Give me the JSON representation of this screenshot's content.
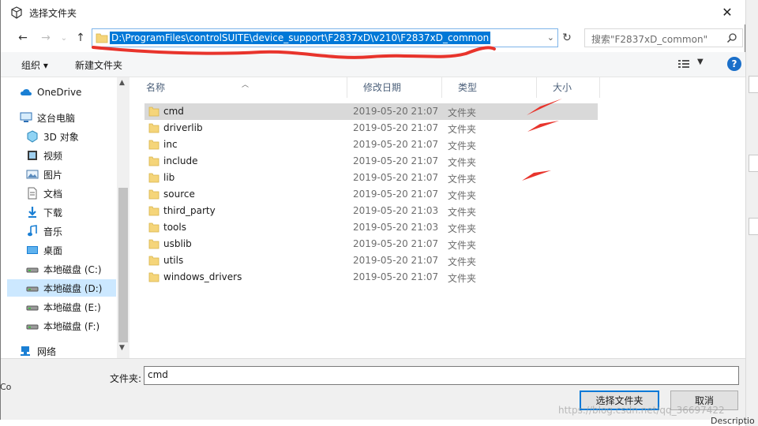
{
  "window": {
    "title": "选择文件夹",
    "close_label": "✕"
  },
  "address": {
    "path": "D:\\ProgramFiles\\controlSUITE\\device_support\\F2837xD\\v210\\F2837xD_common",
    "search_placeholder": "搜索\"F2837xD_common\""
  },
  "toolbar": {
    "organize_label": "组织 ▾",
    "new_folder_label": "新建文件夹",
    "help_label": "?"
  },
  "nav": {
    "items": [
      {
        "label": "OneDrive",
        "icon": "cloud-icon"
      },
      {
        "label": "这台电脑",
        "icon": "computer-icon"
      },
      {
        "label": "3D 对象",
        "icon": "cube-icon"
      },
      {
        "label": "视频",
        "icon": "video-icon"
      },
      {
        "label": "图片",
        "icon": "picture-icon"
      },
      {
        "label": "文档",
        "icon": "document-icon"
      },
      {
        "label": "下载",
        "icon": "download-icon"
      },
      {
        "label": "音乐",
        "icon": "music-icon"
      },
      {
        "label": "桌面",
        "icon": "desktop-icon"
      },
      {
        "label": "本地磁盘 (C:)",
        "icon": "drive-icon"
      },
      {
        "label": "本地磁盘 (D:)",
        "icon": "drive-icon"
      },
      {
        "label": "本地磁盘 (E:)",
        "icon": "drive-icon"
      },
      {
        "label": "本地磁盘 (F:)",
        "icon": "drive-icon"
      },
      {
        "label": "网络",
        "icon": "network-icon"
      }
    ],
    "selected_index": 10
  },
  "columns": {
    "name": "名称",
    "date": "修改日期",
    "type": "类型",
    "size": "大小"
  },
  "files": [
    {
      "name": "cmd",
      "date": "2019-05-20 21:07",
      "type": "文件夹"
    },
    {
      "name": "driverlib",
      "date": "2019-05-20 21:07",
      "type": "文件夹"
    },
    {
      "name": "inc",
      "date": "2019-05-20 21:07",
      "type": "文件夹"
    },
    {
      "name": "include",
      "date": "2019-05-20 21:07",
      "type": "文件夹"
    },
    {
      "name": "lib",
      "date": "2019-05-20 21:07",
      "type": "文件夹"
    },
    {
      "name": "source",
      "date": "2019-05-20 21:07",
      "type": "文件夹"
    },
    {
      "name": "third_party",
      "date": "2019-05-20 21:03",
      "type": "文件夹"
    },
    {
      "name": "tools",
      "date": "2019-05-20 21:03",
      "type": "文件夹"
    },
    {
      "name": "usblib",
      "date": "2019-05-20 21:07",
      "type": "文件夹"
    },
    {
      "name": "utils",
      "date": "2019-05-20 21:07",
      "type": "文件夹"
    },
    {
      "name": "windows_drivers",
      "date": "2019-05-20 21:07",
      "type": "文件夹"
    }
  ],
  "selected_file_index": 0,
  "footer": {
    "folder_label": "文件夹:",
    "folder_value": "cmd",
    "select_button": "选择文件夹",
    "cancel_button": "取消"
  },
  "watermark": "https://blog.csdn.net/qq_36697422",
  "edge_text": {
    "left_fragment": "Co",
    "bottom_fragment": "Descriptio"
  },
  "colors": {
    "accent": "#0078d7",
    "annotation": "#e8342c",
    "folder": "#f5d57a"
  }
}
